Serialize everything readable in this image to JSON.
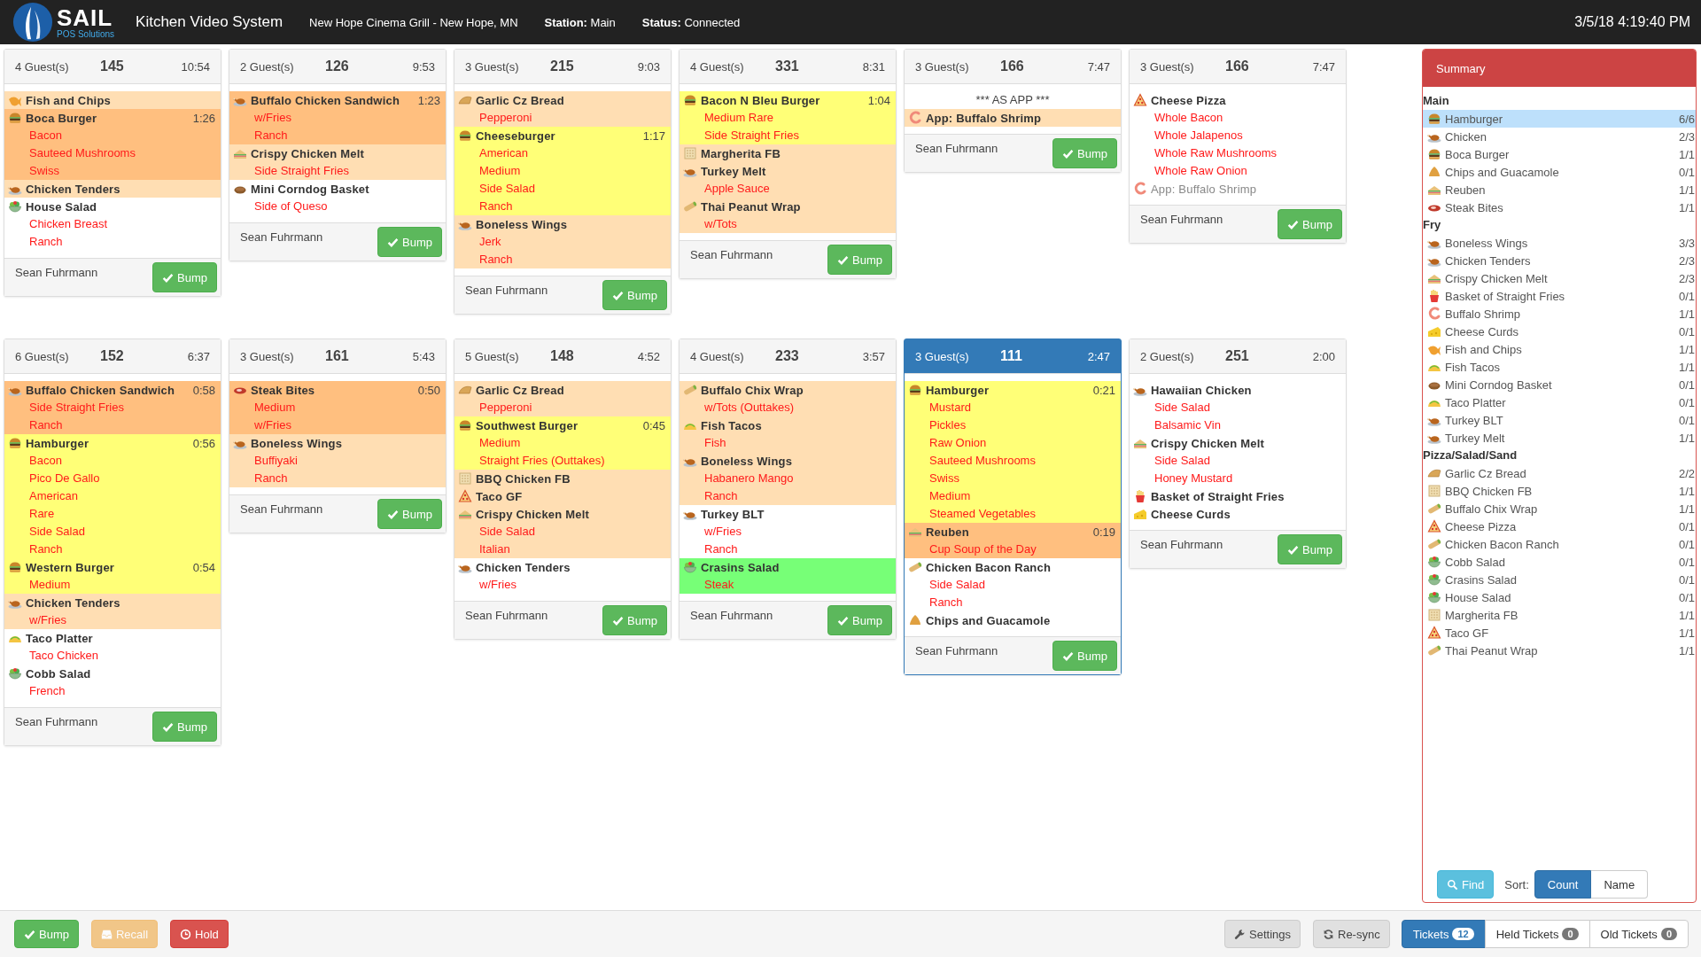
{
  "header": {
    "brand": "SAIL",
    "tagline": "POS Solutions",
    "title": "Kitchen Video System",
    "location": "New Hope Cinema Grill - New Hope, MN",
    "station_label": "Station:",
    "station": "Main",
    "status_label": "Status:",
    "status": "Connected",
    "datetime": "3/5/18 4:19:40 PM"
  },
  "tickets": [
    {
      "guests": "4 Guest(s)",
      "number": "145",
      "time": "10:54",
      "selected": false,
      "server": "Sean Fuhrmann",
      "bump": "Bump",
      "items": [
        {
          "name": "Fish and Chips",
          "kind": "fish",
          "color": "#ffdeb3",
          "muted": false
        },
        {
          "name": "Boca Burger",
          "time": "1:26",
          "kind": "burger",
          "color": "#ffbf7f",
          "muted": false,
          "mods": [
            "Bacon",
            "Sauteed Mushrooms",
            "Swiss"
          ]
        },
        {
          "name": "Chicken Tenders",
          "kind": "poultry",
          "color": "#ffdeb3",
          "muted": false
        },
        {
          "name": "House Salad",
          "kind": "salad",
          "color": "#ffffff",
          "muted": false,
          "mods": [
            "Chicken Breast",
            "Ranch"
          ]
        }
      ]
    },
    {
      "guests": "2 Guest(s)",
      "number": "126",
      "time": "9:53",
      "selected": false,
      "server": "Sean Fuhrmann",
      "bump": "Bump",
      "items": [
        {
          "name": "Buffalo Chicken Sandwich",
          "time": "1:23",
          "kind": "poultry",
          "color": "#ffbf7f",
          "muted": false,
          "mods": [
            "w/Fries",
            "Ranch"
          ]
        },
        {
          "name": "Crispy Chicken Melt",
          "kind": "sandwich",
          "color": "#ffdeb3",
          "muted": false,
          "mods": [
            "Side Straight Fries"
          ]
        },
        {
          "name": "Mini Corndog Basket",
          "kind": "bun",
          "color": "#ffffff",
          "muted": false,
          "mods": [
            "Side of Queso"
          ]
        }
      ]
    },
    {
      "guests": "3 Guest(s)",
      "number": "215",
      "time": "9:03",
      "selected": false,
      "server": "Sean Fuhrmann",
      "bump": "Bump",
      "items": [
        {
          "name": "Garlic Cz Bread",
          "kind": "bread",
          "color": "#ffdeb3",
          "muted": false,
          "mods": [
            "Pepperoni"
          ]
        },
        {
          "name": "Cheeseburger",
          "time": "1:17",
          "kind": "burger",
          "color": "#ffff77",
          "muted": false,
          "mods": [
            "American",
            "Medium",
            "Side Salad",
            "Ranch"
          ]
        },
        {
          "name": "Boneless Wings",
          "kind": "poultry",
          "color": "#ffdeb3",
          "muted": false,
          "mods": [
            "Jerk",
            "Ranch"
          ]
        }
      ]
    },
    {
      "guests": "4 Guest(s)",
      "number": "331",
      "time": "8:31",
      "selected": false,
      "server": "Sean Fuhrmann",
      "bump": "Bump",
      "items": [
        {
          "name": "Bacon N Bleu Burger",
          "time": "1:04",
          "kind": "burger",
          "color": "#ffff77",
          "muted": false,
          "mods": [
            "Medium Rare",
            "Side Straight Fries"
          ]
        },
        {
          "name": "Margherita FB",
          "kind": "flatbread",
          "color": "#ffdeb3",
          "muted": false
        },
        {
          "name": "Turkey Melt",
          "kind": "poultry",
          "color": "#ffdeb3",
          "muted": false,
          "mods": [
            "Apple Sauce"
          ]
        },
        {
          "name": "Thai Peanut Wrap",
          "kind": "wrap",
          "color": "#ffdeb3",
          "muted": false,
          "mods": [
            "w/Tots"
          ]
        }
      ]
    },
    {
      "guests": "3 Guest(s)",
      "number": "166",
      "time": "7:47",
      "selected": false,
      "server": "Sean Fuhrmann",
      "bump": "Bump",
      "note": "*** AS APP ***",
      "items": [
        {
          "name": "App: Buffalo Shrimp",
          "kind": "shrimp",
          "color": "#ffdeb3",
          "muted": false
        }
      ]
    },
    {
      "guests": "3 Guest(s)",
      "number": "166",
      "time": "7:47",
      "selected": false,
      "server": "Sean Fuhrmann",
      "bump": "Bump",
      "items": [
        {
          "name": "Cheese Pizza",
          "kind": "pizza",
          "color": "#ffffff",
          "muted": false,
          "mods": [
            "Whole Bacon",
            "Whole Jalapenos",
            "Whole Raw Mushrooms",
            "Whole Raw Onion"
          ]
        },
        {
          "name": "App: Buffalo Shrimp",
          "kind": "shrimp",
          "color": "#ffffff",
          "muted": true
        }
      ]
    },
    {
      "guests": "6 Guest(s)",
      "number": "152",
      "time": "6:37",
      "selected": false,
      "server": "Sean Fuhrmann",
      "bump": "Bump",
      "items": [
        {
          "name": "Buffalo Chicken Sandwich",
          "time": "0:58",
          "kind": "poultry",
          "color": "#ffbf7f",
          "muted": false,
          "mods": [
            "Side Straight Fries",
            "Ranch"
          ]
        },
        {
          "name": "Hamburger",
          "time": "0:56",
          "kind": "burger",
          "color": "#ffff77",
          "muted": false,
          "mods": [
            "Bacon",
            "Pico De Gallo",
            "American",
            "Rare",
            "Side Salad",
            "Ranch"
          ]
        },
        {
          "name": "Western Burger",
          "time": "0:54",
          "kind": "burger",
          "color": "#ffff77",
          "muted": false,
          "mods": [
            "Medium"
          ]
        },
        {
          "name": "Chicken Tenders",
          "kind": "poultry",
          "color": "#ffdeb3",
          "muted": false,
          "mods": [
            "w/Fries"
          ]
        },
        {
          "name": "Taco Platter",
          "kind": "taco",
          "color": "#ffffff",
          "muted": false,
          "mods": [
            "Taco Chicken"
          ]
        },
        {
          "name": "Cobb Salad",
          "kind": "salad",
          "color": "#ffffff",
          "muted": false,
          "mods": [
            "French"
          ]
        }
      ]
    },
    {
      "guests": "3 Guest(s)",
      "number": "161",
      "time": "5:43",
      "selected": false,
      "server": "Sean Fuhrmann",
      "bump": "Bump",
      "items": [
        {
          "name": "Steak Bites",
          "time": "0:50",
          "kind": "steak",
          "color": "#ffbf7f",
          "muted": false,
          "mods": [
            "Medium",
            "w/Fries"
          ]
        },
        {
          "name": "Boneless Wings",
          "kind": "poultry",
          "color": "#ffdeb3",
          "muted": false,
          "mods": [
            "Buffiyaki",
            "Ranch"
          ]
        }
      ]
    },
    {
      "guests": "5 Guest(s)",
      "number": "148",
      "time": "4:52",
      "selected": false,
      "server": "Sean Fuhrmann",
      "bump": "Bump",
      "items": [
        {
          "name": "Garlic Cz Bread",
          "kind": "bread",
          "color": "#ffdeb3",
          "muted": false,
          "mods": [
            "Pepperoni"
          ]
        },
        {
          "name": "Southwest Burger",
          "time": "0:45",
          "kind": "burger",
          "color": "#ffff77",
          "muted": false,
          "mods": [
            "Medium",
            "Straight Fries (Outtakes)"
          ]
        },
        {
          "name": "BBQ Chicken FB",
          "kind": "flatbread",
          "color": "#ffdeb3",
          "muted": false
        },
        {
          "name": "Taco GF",
          "kind": "pizza",
          "color": "#ffdeb3",
          "muted": false
        },
        {
          "name": "Crispy Chicken Melt",
          "kind": "sandwich",
          "color": "#ffdeb3",
          "muted": false,
          "mods": [
            "Side Salad",
            "Italian"
          ]
        },
        {
          "name": "Chicken Tenders",
          "kind": "poultry",
          "color": "#ffffff",
          "muted": false,
          "mods": [
            "w/Fries"
          ]
        }
      ]
    },
    {
      "guests": "4 Guest(s)",
      "number": "233",
      "time": "3:57",
      "selected": false,
      "server": "Sean Fuhrmann",
      "bump": "Bump",
      "items": [
        {
          "name": "Buffalo Chix Wrap",
          "kind": "wrap",
          "color": "#ffdeb3",
          "muted": false,
          "mods": [
            "w/Tots (Outtakes)"
          ]
        },
        {
          "name": "Fish Tacos",
          "kind": "taco",
          "color": "#ffdeb3",
          "muted": false,
          "mods": [
            "Fish"
          ]
        },
        {
          "name": "Boneless Wings",
          "kind": "poultry",
          "color": "#ffdeb3",
          "muted": false,
          "mods": [
            "Habanero Mango",
            "Ranch"
          ]
        },
        {
          "name": "Turkey BLT",
          "kind": "poultry",
          "color": "#ffffff",
          "muted": false,
          "mods": [
            "w/Fries",
            "Ranch"
          ]
        },
        {
          "name": "Crasins Salad",
          "kind": "salad",
          "color": "#77ff77",
          "muted": false,
          "mods": [
            "Steak"
          ]
        }
      ]
    },
    {
      "guests": "3 Guest(s)",
      "number": "111",
      "time": "2:47",
      "selected": true,
      "server": "Sean Fuhrmann",
      "bump": "Bump",
      "items": [
        {
          "name": "Hamburger",
          "time": "0:21",
          "kind": "burger",
          "color": "#ffff77",
          "muted": false,
          "mods": [
            "Mustard",
            "Pickles",
            "Raw Onion",
            "Sauteed Mushrooms",
            "Swiss",
            "Medium",
            "Steamed Vegetables"
          ]
        },
        {
          "name": "Reuben",
          "time": "0:19",
          "kind": "sandwich",
          "color": "#ffbf7f",
          "muted": false,
          "mods": [
            "Cup Soup of the Day"
          ]
        },
        {
          "name": "Chicken Bacon Ranch",
          "kind": "wrap",
          "color": "#ffffff",
          "muted": false,
          "mods": [
            "Side Salad",
            "Ranch"
          ]
        },
        {
          "name": "Chips and Guacamole",
          "kind": "chips",
          "color": "#ffffff",
          "muted": false
        }
      ]
    },
    {
      "guests": "2 Guest(s)",
      "number": "251",
      "time": "2:00",
      "selected": false,
      "server": "Sean Fuhrmann",
      "bump": "Bump",
      "items": [
        {
          "name": "Hawaiian Chicken",
          "kind": "poultry",
          "color": "#ffffff",
          "muted": false,
          "mods": [
            "Side Salad",
            "Balsamic Vin"
          ]
        },
        {
          "name": "Crispy Chicken Melt",
          "kind": "sandwich",
          "color": "#ffffff",
          "muted": false,
          "mods": [
            "Side Salad",
            "Honey Mustard"
          ]
        },
        {
          "name": "Basket of Straight Fries",
          "kind": "fries",
          "color": "#ffffff",
          "muted": false
        },
        {
          "name": "Cheese Curds",
          "kind": "cheese",
          "color": "#ffffff",
          "muted": false
        }
      ]
    }
  ],
  "summary": {
    "title": "Summary",
    "groups": [
      {
        "title": "Main",
        "items": [
          {
            "name": "Hamburger",
            "kind": "burger",
            "count": "6/6",
            "selected": true
          },
          {
            "name": "Chicken",
            "kind": "poultry",
            "count": "2/3",
            "selected": false
          },
          {
            "name": "Boca Burger",
            "kind": "burger",
            "count": "1/1",
            "selected": false
          },
          {
            "name": "Chips and Guacamole",
            "kind": "chips",
            "count": "0/1",
            "selected": false
          },
          {
            "name": "Reuben",
            "kind": "sandwich",
            "count": "1/1",
            "selected": false
          },
          {
            "name": "Steak Bites",
            "kind": "steak",
            "count": "1/1",
            "selected": false
          }
        ]
      },
      {
        "title": "Fry",
        "items": [
          {
            "name": "Boneless Wings",
            "kind": "poultry",
            "count": "3/3",
            "selected": false
          },
          {
            "name": "Chicken Tenders",
            "kind": "poultry",
            "count": "2/3",
            "selected": false
          },
          {
            "name": "Crispy Chicken Melt",
            "kind": "sandwich",
            "count": "2/3",
            "selected": false
          },
          {
            "name": "Basket of Straight Fries",
            "kind": "fries",
            "count": "0/1",
            "selected": false
          },
          {
            "name": "Buffalo Shrimp",
            "kind": "shrimp",
            "count": "1/1",
            "selected": false
          },
          {
            "name": "Cheese Curds",
            "kind": "cheese",
            "count": "0/1",
            "selected": false
          },
          {
            "name": "Fish and Chips",
            "kind": "fish",
            "count": "1/1",
            "selected": false
          },
          {
            "name": "Fish Tacos",
            "kind": "taco",
            "count": "1/1",
            "selected": false
          },
          {
            "name": "Mini Corndog Basket",
            "kind": "bun",
            "count": "0/1",
            "selected": false
          },
          {
            "name": "Taco Platter",
            "kind": "taco",
            "count": "0/1",
            "selected": false
          },
          {
            "name": "Turkey BLT",
            "kind": "poultry",
            "count": "0/1",
            "selected": false
          },
          {
            "name": "Turkey Melt",
            "kind": "poultry",
            "count": "1/1",
            "selected": false
          }
        ]
      },
      {
        "title": "Pizza/Salad/Sand",
        "items": [
          {
            "name": "Garlic Cz Bread",
            "kind": "bread",
            "count": "2/2",
            "selected": false
          },
          {
            "name": "BBQ Chicken FB",
            "kind": "flatbread",
            "count": "1/1",
            "selected": false
          },
          {
            "name": "Buffalo Chix Wrap",
            "kind": "wrap",
            "count": "1/1",
            "selected": false
          },
          {
            "name": "Cheese Pizza",
            "kind": "pizza",
            "count": "0/1",
            "selected": false
          },
          {
            "name": "Chicken Bacon Ranch",
            "kind": "wrap",
            "count": "0/1",
            "selected": false
          },
          {
            "name": "Cobb Salad",
            "kind": "salad",
            "count": "0/1",
            "selected": false
          },
          {
            "name": "Crasins Salad",
            "kind": "salad",
            "count": "0/1",
            "selected": false
          },
          {
            "name": "House Salad",
            "kind": "salad",
            "count": "0/1",
            "selected": false
          },
          {
            "name": "Margherita FB",
            "kind": "flatbread",
            "count": "1/1",
            "selected": false
          },
          {
            "name": "Taco GF",
            "kind": "pizza",
            "count": "1/1",
            "selected": false
          },
          {
            "name": "Thai Peanut Wrap",
            "kind": "wrap",
            "count": "1/1",
            "selected": false
          }
        ]
      }
    ],
    "find": "Find",
    "sort_label": "Sort:",
    "sort_options": [
      {
        "label": "Count",
        "selected": true
      },
      {
        "label": "Name",
        "selected": false
      }
    ]
  },
  "actions": [
    {
      "kind": "bump",
      "label": "Bump",
      "disabled": false
    },
    {
      "kind": "recall",
      "label": "Recall",
      "disabled": true
    },
    {
      "kind": "hold",
      "label": "Hold",
      "disabled": false
    }
  ],
  "tools": [
    {
      "kind": "settings",
      "label": "Settings"
    },
    {
      "kind": "resync",
      "label": "Re-sync"
    }
  ],
  "views": [
    {
      "label": "Tickets",
      "count": "12",
      "selected": true
    },
    {
      "label": "Held Tickets",
      "count": "0",
      "selected": false
    },
    {
      "label": "Old Tickets",
      "count": "0",
      "selected": false
    }
  ]
}
